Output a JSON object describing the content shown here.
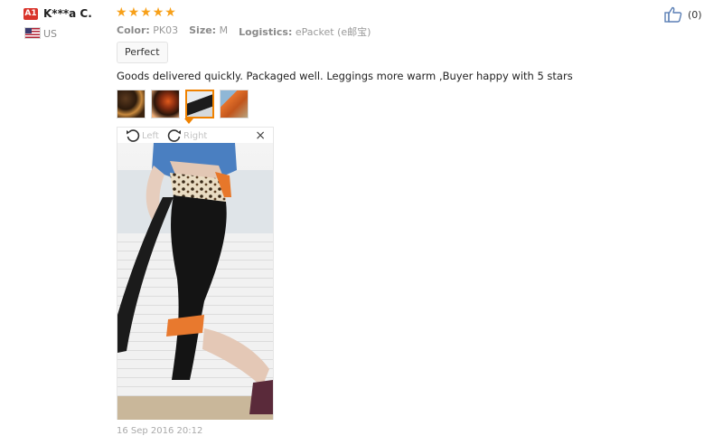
{
  "reviewer": {
    "level_badge": "A1",
    "name": "K***a C.",
    "country": "US"
  },
  "review": {
    "rating": 5,
    "stars": [
      "★",
      "★",
      "★",
      "★",
      "★"
    ],
    "meta": [
      {
        "key": "Color:",
        "value": "PK03"
      },
      {
        "key": "Size:",
        "value": "M"
      },
      {
        "key": "Logistics:",
        "value": "ePacket (e邮宝)"
      }
    ],
    "tag": "Perfect",
    "text": "Goods delivered quickly. Packaged well. Leggings more warm ,Buyer happy with 5 stars",
    "date": "16 Sep 2016 20:12"
  },
  "thumbnails": [
    {
      "name": "photo-1",
      "active": false
    },
    {
      "name": "photo-2",
      "active": false
    },
    {
      "name": "photo-3",
      "active": true
    },
    {
      "name": "photo-4",
      "active": false
    }
  ],
  "viewer": {
    "rotate_left_label": "Left",
    "rotate_right_label": "Right",
    "close_glyph": "×"
  },
  "helpful": {
    "count": "(0)"
  },
  "colors": {
    "star": "#f7a019",
    "accent": "#f08200",
    "badge": "#d9342b"
  },
  "icons": {
    "rotate_left": "rotate-left-icon",
    "rotate_right": "rotate-right-icon",
    "like": "thumbs-up-icon",
    "close": "close-icon",
    "flag": "us-flag-icon"
  }
}
